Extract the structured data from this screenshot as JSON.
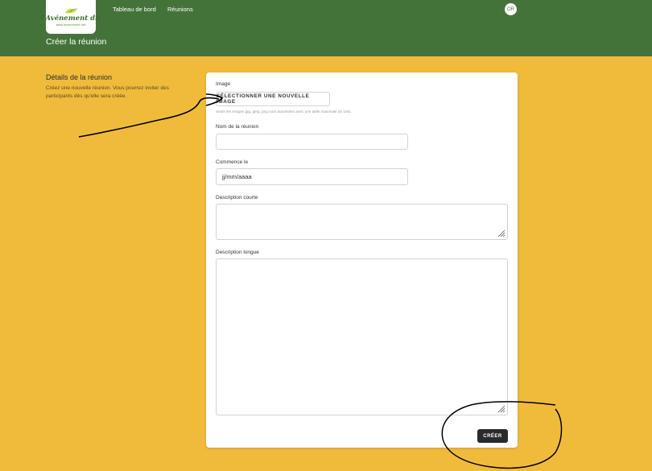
{
  "header": {
    "logo_text": "l'Avénement dit",
    "logo_url": "www.lavenement.net",
    "nav": [
      "Tableau de bord",
      "Réunions"
    ],
    "avatar_initials": "OR",
    "page_title": "Créer la réunion"
  },
  "intro": {
    "title": "Détails de la réunion",
    "description": "Créez une nouvelle réunion. Vous pourrez inviter des participants dès qu'elle sera créée."
  },
  "form": {
    "image_label": "Image",
    "upload_button": "SÉLECTIONNER UNE NOUVELLE IMAGE",
    "image_hint": "Seuls les images jpg, jpeg, png sont autorisées avec une taille maximale de 1Mo.",
    "name_label": "Nom de la réunion",
    "name_value": "",
    "start_label": "Commence le",
    "start_value": "jj/mm/aaaa",
    "short_desc_label": "Description courte",
    "long_desc_label": "Description longue",
    "submit_button": "CRÉER"
  },
  "colors": {
    "header_bg": "#44733a",
    "page_bg": "#f0bb3b",
    "button_dark": "#2b2b2b"
  }
}
